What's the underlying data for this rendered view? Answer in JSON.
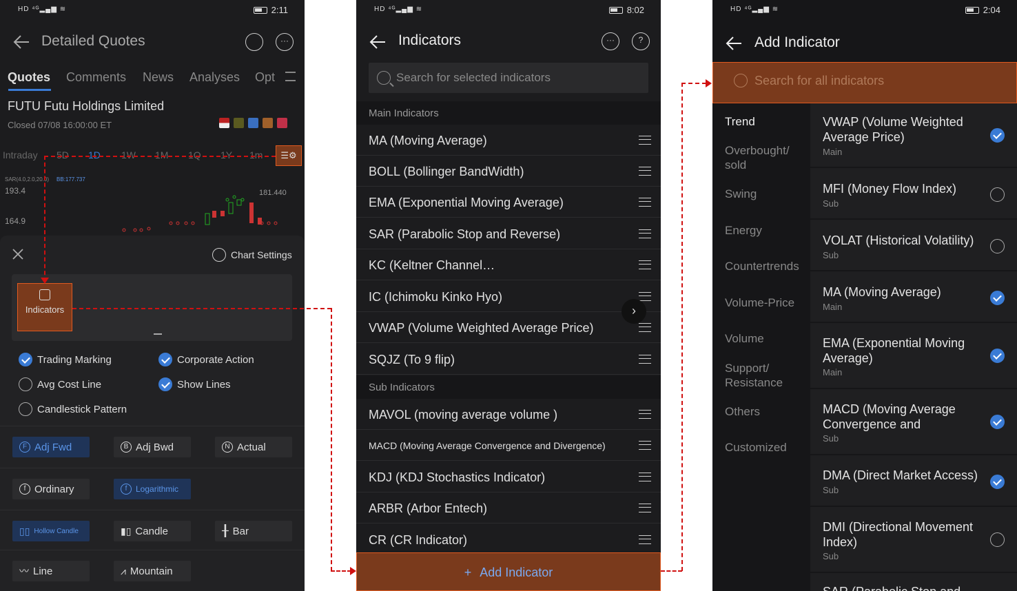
{
  "p1": {
    "status_time": "2:11",
    "title": "Detailed Quotes",
    "tabs": [
      "Quotes",
      "Comments",
      "News",
      "Analyses",
      "Opt"
    ],
    "stock": {
      "ticker": "FUTU",
      "name": "Futu Holdings Limited",
      "status": "Closed",
      "datetime": "07/08 16:00:00 ET"
    },
    "ranges": [
      "Intraday",
      "5D",
      "1D",
      "1W",
      "1M",
      "1Q",
      "1Y",
      "1m"
    ],
    "chart": {
      "indicator": "SAR(4.0,2.0,20.0)",
      "bb": "BB:177.737",
      "y_high": "193.4",
      "y_low": "164.9",
      "peak": "181.440"
    },
    "chart_settings": "Chart Settings",
    "indicators_btn": "Indicators",
    "checks": [
      {
        "label": "Trading Marking",
        "on": true
      },
      {
        "label": "Corporate Action",
        "on": true
      },
      {
        "label": "Avg Cost Line",
        "on": false
      },
      {
        "label": "Show Lines",
        "on": true
      },
      {
        "label": "Candlestick Pattern",
        "on": false
      }
    ],
    "options": [
      "Adj Fwd",
      "Adj Bwd",
      "Actual",
      "Ordinary",
      "Logarithmic",
      "Hollow Candle",
      "Candle",
      "Bar",
      "Line",
      "Mountain"
    ]
  },
  "p2": {
    "status_time": "8:02",
    "title": "Indicators",
    "search_placeholder": "Search for selected indicators",
    "main_header": "Main Indicators",
    "main": [
      "MA (Moving Average)",
      "BOLL (Bollinger BandWidth)",
      "EMA (Exponential Moving Average)",
      "SAR (Parabolic Stop and Reverse)",
      "KC (Keltner Channel…",
      "IC (Ichimoku Kinko Hyo)",
      "VWAP (Volume Weighted Average Price)",
      "SQJZ (To 9 flip)"
    ],
    "sub_header": "Sub Indicators",
    "sub": [
      "MAVOL (moving average volume )",
      "MACD (Moving Average Convergence and Divergence)",
      "KDJ (KDJ Stochastics Indicator)",
      "ARBR (Arbor Entech)",
      "CR (CR Indicator)"
    ],
    "add": "Add Indicator"
  },
  "p3": {
    "status_time": "2:04",
    "title": "Add Indicator",
    "search_placeholder": "Search for all indicators",
    "categories": [
      "Trend",
      "Overbought/ sold",
      "Swing",
      "Energy",
      "Countertrends",
      "Volume-Price",
      "Volume",
      "Support/ Resistance",
      "Others",
      "Customized"
    ],
    "items": [
      {
        "name": "VWAP (Volume Weighted Average Price)",
        "type": "Main",
        "on": true
      },
      {
        "name": "MFI (Money Flow Index)",
        "type": "Sub",
        "on": false
      },
      {
        "name": "VOLAT (Historical Volatility)",
        "type": "Sub",
        "on": false
      },
      {
        "name": "MA (Moving Average)",
        "type": "Main",
        "on": true
      },
      {
        "name": "EMA (Exponential Moving Average)",
        "type": "Main",
        "on": true
      },
      {
        "name": "MACD (Moving Average Convergence and",
        "type": "Sub",
        "on": true
      },
      {
        "name": "DMA (Direct Market Access)",
        "type": "Sub",
        "on": true
      },
      {
        "name": "DMI (Directional Movement Index)",
        "type": "Sub",
        "on": false
      },
      {
        "name": "SAR (Parabolic Stop and",
        "type": "",
        "on": false
      }
    ]
  },
  "colors": {
    "accent": "#3a7bd5",
    "highlight": "#e05a20",
    "highlight_fill": "#7a3a1c",
    "annotation": "#d01010"
  }
}
